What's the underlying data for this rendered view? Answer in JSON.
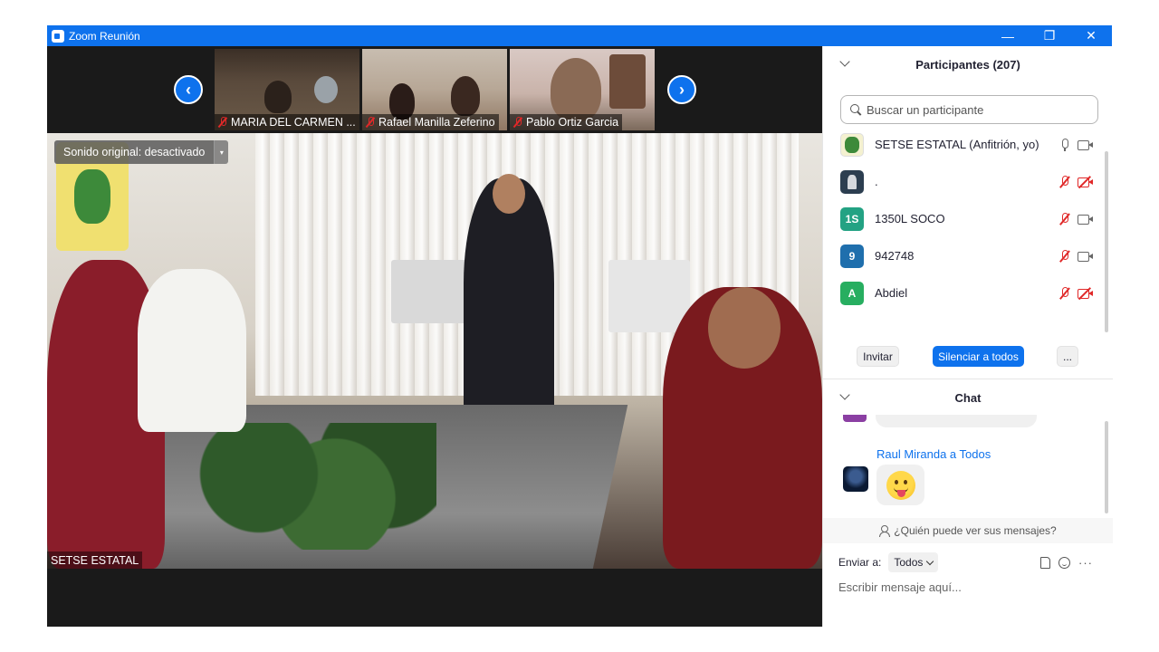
{
  "window": {
    "title": "Zoom Reunión",
    "controls": {
      "minimize": "—",
      "restore": "❐",
      "close": "✕"
    }
  },
  "gallery": {
    "prev_icon": "‹",
    "next_icon": "›",
    "thumbnails": [
      {
        "name": "MARIA DEL CARMEN ...",
        "muted": true
      },
      {
        "name": "Rafael Manilla Zeferino",
        "muted": true
      },
      {
        "name": "Pablo Ortiz Garcia",
        "muted": true
      }
    ]
  },
  "main_video": {
    "original_sound_label": "Sonido original: desactivado",
    "dropdown_icon": "▾",
    "speaker_name": "SETSE ESTATAL"
  },
  "participants": {
    "title": "Participantes (207)",
    "search_placeholder": "Buscar un participante",
    "list": [
      {
        "name": "SETSE ESTATAL (Anfitrión, yo)",
        "avatar_text": "",
        "avatar_color": "#f4f1d0",
        "mic_muted": false,
        "video_off": false
      },
      {
        "name": ".",
        "avatar_text": "",
        "avatar_color": "#2c3e50",
        "mic_muted": true,
        "video_off": true
      },
      {
        "name": "1350L SOCO",
        "avatar_text": "1S",
        "avatar_color": "#23a283",
        "mic_muted": true,
        "video_off": false
      },
      {
        "name": "942748",
        "avatar_text": "9",
        "avatar_color": "#1f6fad",
        "mic_muted": true,
        "video_off": false
      },
      {
        "name": "Abdiel",
        "avatar_text": "A",
        "avatar_color": "#27ae60",
        "mic_muted": true,
        "video_off": true
      }
    ],
    "buttons": {
      "invite": "Invitar",
      "mute_all": "Silenciar a todos",
      "more": "..."
    }
  },
  "chat": {
    "title": "Chat",
    "message": {
      "sender": "Raul Miranda a Todos",
      "content_icon": "tongue-emoji"
    },
    "who_can_see": "¿Quién puede ver sus mensajes?",
    "send_to_label": "Enviar a:",
    "send_to_value": "Todos",
    "more": "···",
    "input_placeholder": "Escribir mensaje aquí..."
  },
  "colors": {
    "accent": "#0e72ed",
    "muted_red": "#e02828"
  }
}
